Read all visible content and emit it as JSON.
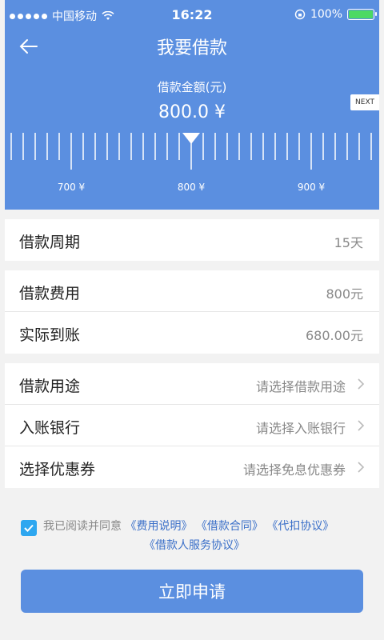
{
  "status": {
    "carrier": "中国移动",
    "time": "16:22",
    "battery": "100%"
  },
  "nav": {
    "title": "我要借款"
  },
  "slider": {
    "label": "借款金额(元)",
    "value": "800.0 ¥",
    "next_label": "NEXT",
    "ticks": [
      "700 ¥",
      "800 ¥",
      "900 ¥"
    ],
    "selected": 800
  },
  "loan_info": {
    "period_label": "借款周期",
    "period_value": "15天",
    "fee_label": "借款费用",
    "fee_value": "800元",
    "received_label": "实际到账",
    "received_value": "680.00元"
  },
  "options": {
    "purpose_label": "借款用途",
    "purpose_placeholder": "请选择借款用途",
    "bank_label": "入账银行",
    "bank_placeholder": "请选择入账银行",
    "coupon_label": "选择优惠券",
    "coupon_placeholder": "请选择免息优惠券"
  },
  "agreement": {
    "prefix": "我已阅读并同意",
    "link1": "《费用说明》",
    "link2": "《借款合同》",
    "link3": "《代扣协议》",
    "link4": "《借款人服务协议》",
    "checked": true
  },
  "submit_label": "立即申请",
  "colors": {
    "primary": "#5b8fe0",
    "checkbox": "#2ea7f0",
    "link": "#3a6fc8"
  }
}
